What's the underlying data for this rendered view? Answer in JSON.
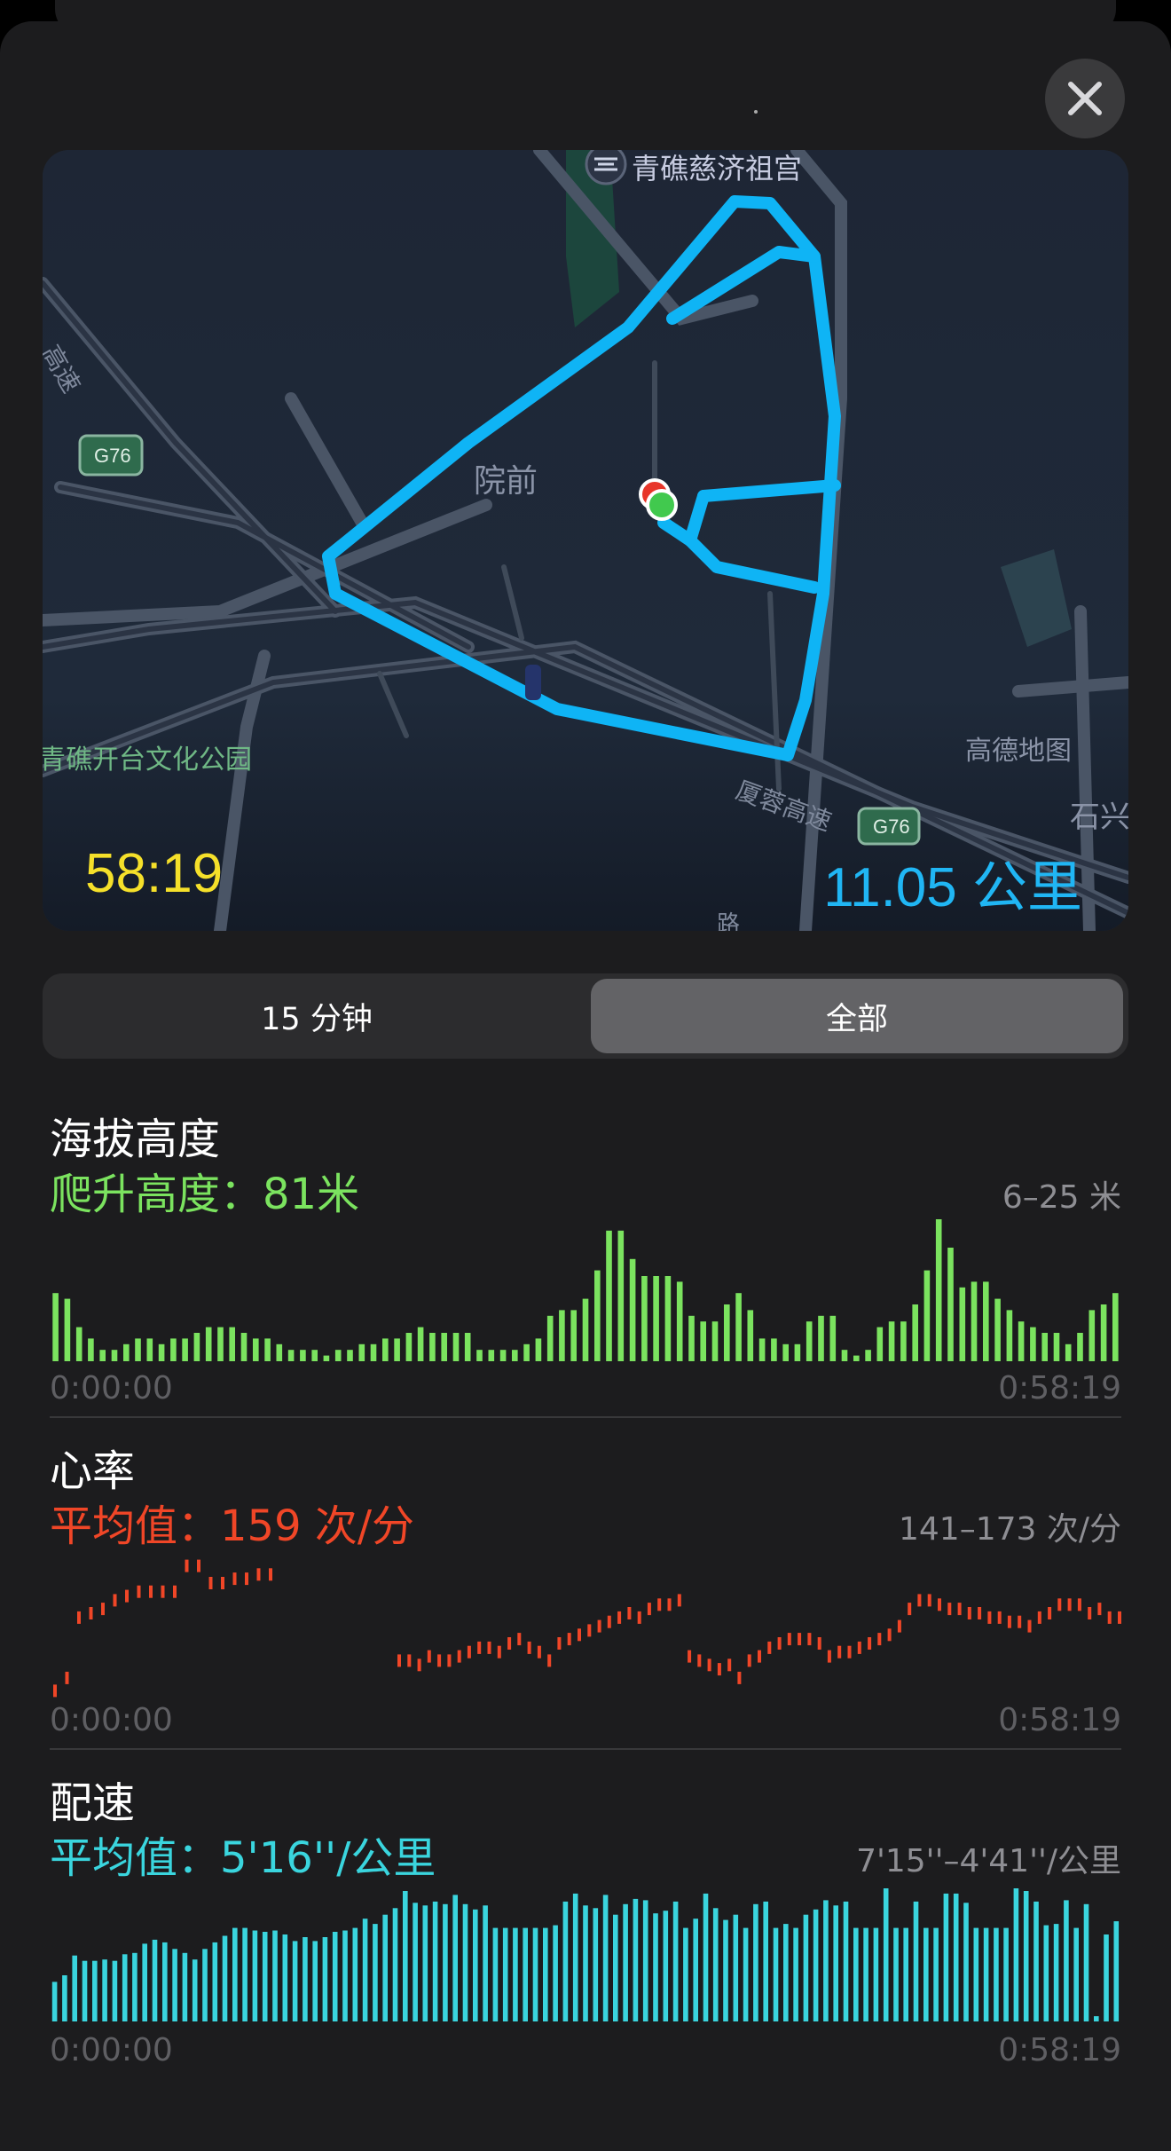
{
  "header": {
    "close_icon": "close-icon"
  },
  "map": {
    "labels": {
      "temple": "青礁慈济祖宫",
      "village": "院前",
      "park": "青礁开台文化公园",
      "highway": "厦蓉高速",
      "highway_left": "高速",
      "shield": "G76",
      "watermark": "高德地图",
      "edge": "石兴",
      "road_bottom": "路"
    },
    "time": "58:19",
    "distance": "11.05 公里",
    "route_color": "#0fb4f5"
  },
  "segment": {
    "options": [
      "15 分钟",
      "全部"
    ],
    "selected": "全部"
  },
  "elevation": {
    "title": "海拔高度",
    "subtitle": "爬升高度：81米",
    "range": "6–25 米",
    "start": "0:00:00",
    "end": "0:58:19",
    "color": "#7be35f",
    "values": [
      12,
      11,
      6,
      4,
      2,
      2,
      3,
      4,
      4,
      3,
      4,
      4,
      5,
      6,
      6,
      6,
      5,
      4,
      4,
      3,
      2,
      2,
      2,
      1,
      2,
      2,
      3,
      3,
      4,
      4,
      5,
      6,
      5,
      5,
      5,
      5,
      2,
      2,
      2,
      2,
      3,
      4,
      8,
      9,
      9,
      11,
      16,
      23,
      23,
      18,
      15,
      15,
      15,
      14,
      8,
      7,
      7,
      10,
      12,
      9,
      4,
      4,
      3,
      3,
      7,
      8,
      8,
      2,
      1,
      2,
      6,
      7,
      7,
      10,
      16,
      25,
      20,
      13,
      14,
      14,
      11,
      9,
      7,
      6,
      5,
      5,
      3,
      5,
      9,
      10,
      12
    ]
  },
  "heart_rate": {
    "title": "心率",
    "subtitle": "平均值：159 次/分",
    "range": "141–173 次/分",
    "start": "0:00:00",
    "end": "0:58:19",
    "color": "#f04627",
    "values": [
      143,
      146,
      160,
      161,
      162,
      164,
      165,
      166,
      166,
      166,
      166,
      null,
      null,
      null,
      172,
      172,
      null,
      null,
      null,
      168,
      168,
      169,
      169,
      170,
      170,
      null,
      null,
      null,
      null,
      null,
      null,
      null,
      null,
      null,
      null,
      null,
      null,
      null,
      null,
      null,
      null,
      null,
      null,
      null,
      null,
      null,
      null,
      null,
      null,
      null,
      null,
      null,
      null,
      null,
      null,
      null,
      null,
      null,
      null,
      null,
      null,
      null,
      null,
      null,
      null,
      null,
      null,
      null,
      null,
      null,
      null,
      null,
      null,
      null,
      null,
      null,
      null,
      null,
      null,
      null,
      null,
      null,
      null,
      null,
      null,
      null,
      null,
      null,
      null,
      null,
      null,
      null,
      null,
      null,
      null,
      null,
      null,
      null,
      null,
      null,
      null,
      null,
      null,
      null,
      null,
      null,
      null,
      null,
      null,
      null,
      null,
      null,
      null,
      null,
      null,
      null,
      null,
      null,
      null,
      null,
      null,
      null,
      null,
      null,
      null,
      null,
      null,
      null,
      null,
      null,
      null,
      null,
      null,
      null,
      null,
      null,
      null,
      null,
      null,
      null,
      null,
      null,
      null,
      null,
      null,
      null,
      null,
      null,
      null,
      null,
      null,
      null,
      null,
      null,
      null,
      null,
      null,
      null,
      null,
      null,
      null,
      null,
      null,
      null,
      null,
      null,
      null,
      null,
      null,
      null
    ],
    "values2": [
      150,
      150,
      149,
      151,
      150,
      150,
      151,
      152,
      153,
      153,
      152,
      154,
      155,
      153,
      152,
      150,
      154,
      155,
      156,
      157,
      158,
      159,
      160,
      161,
      160,
      162,
      163,
      163,
      164,
      151,
      150,
      149,
      148,
      149,
      146,
      150,
      151,
      153,
      154,
      155,
      155,
      155,
      154,
      151,
      152,
      152,
      153,
      154,
      155,
      156,
      158,
      162,
      164,
      164,
      163,
      162,
      162,
      161,
      161,
      160,
      160,
      159,
      159,
      158,
      160,
      161,
      163,
      163,
      163,
      161,
      162,
      160,
      160
    ]
  },
  "pace": {
    "title": "配速",
    "subtitle": "平均值：5'16''/公里",
    "range": "7'15''–4'41''/公里",
    "start": "0:00:00",
    "end": "0:58:19",
    "color": "#3ad5de",
    "values": [
      30,
      35,
      50,
      46,
      46,
      47,
      46,
      51,
      52,
      59,
      62,
      60,
      55,
      52,
      47,
      55,
      60,
      65,
      71,
      71,
      69,
      68,
      69,
      66,
      61,
      64,
      61,
      64,
      68,
      69,
      71,
      78,
      74,
      81,
      86,
      99,
      90,
      88,
      91,
      89,
      96,
      89,
      85,
      88,
      71,
      71,
      71,
      71,
      71,
      71,
      73,
      91,
      97,
      88,
      86,
      96,
      81,
      89,
      93,
      92,
      82,
      84,
      91,
      71,
      78,
      97,
      86,
      77,
      81,
      71,
      89,
      91,
      71,
      74,
      71,
      81,
      85,
      92,
      88,
      91,
      71,
      71,
      71,
      101,
      71,
      71,
      91,
      71,
      71,
      97,
      97,
      90,
      71,
      71,
      71,
      71,
      101,
      99,
      91,
      73,
      74,
      92,
      71,
      89,
      4,
      66,
      76
    ]
  }
}
